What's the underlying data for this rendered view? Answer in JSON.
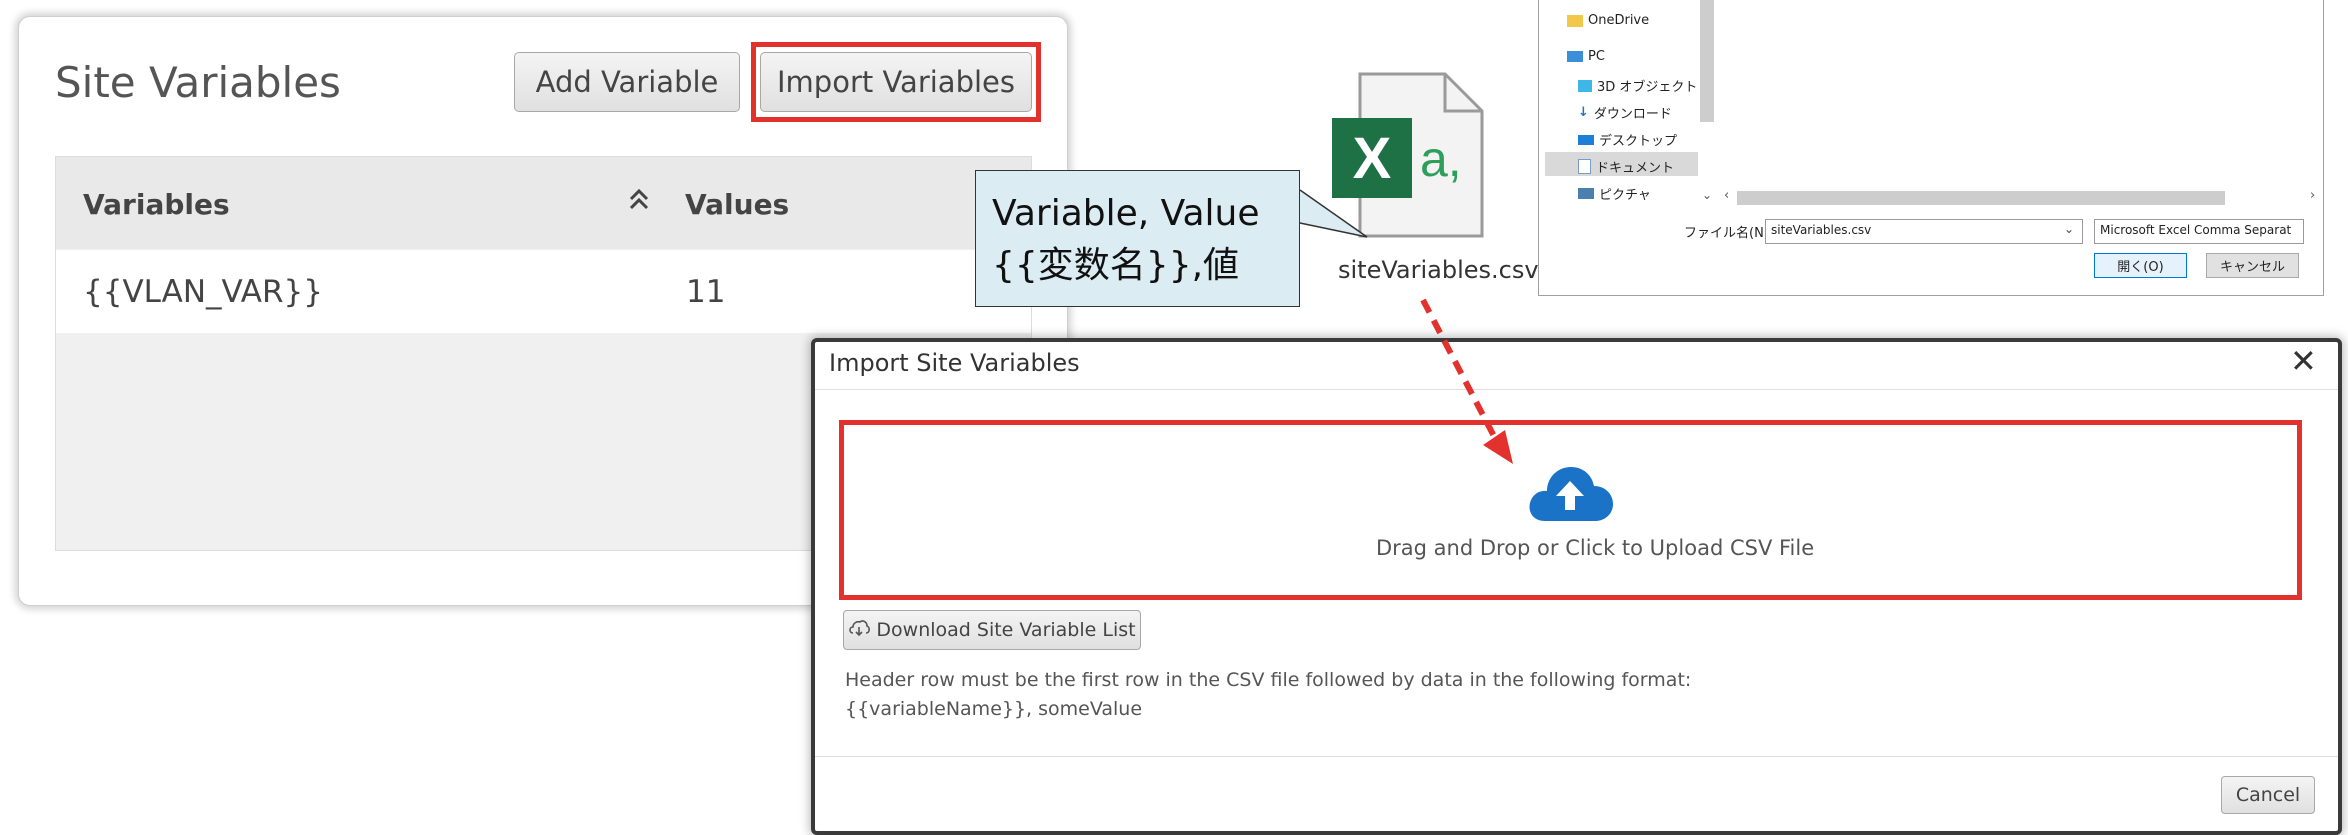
{
  "site_variables": {
    "title": "Site Variables",
    "add_label": "Add Variable",
    "import_label": "Import Variables",
    "columns": [
      "Variables",
      "Values"
    ],
    "rows": [
      {
        "variable": "{{VLAN_VAR}}",
        "value": "11"
      }
    ]
  },
  "callout": {
    "line1": "Variable, Value",
    "line2": "{{変数名}},値",
    "file_name": "siteVariables.csv",
    "file_icon_letter": "X",
    "file_icon_suffix": "a,"
  },
  "file_dialog": {
    "tree": [
      "OneDrive",
      "PC",
      "3D オブジェクト",
      "ダウンロード",
      "デスクトップ",
      "ドキュメント",
      "ピクチャ"
    ],
    "filename_label": "ファイル名(N):",
    "filename_value": "siteVariables.csv",
    "filter_value": "Microsoft Excel Comma Separat",
    "open_label": "開く(O)",
    "cancel_label": "キャンセル"
  },
  "import_modal": {
    "title": "Import Site Variables",
    "close_glyph": "✕",
    "drop_text": "Drag and Drop or Click to Upload CSV File",
    "download_label": "Download Site Variable List",
    "hint_line1": "Header row must be the first row in the CSV file followed by data in the following format:",
    "hint_line2": "{{variableName}}, someValue",
    "cancel_label": "Cancel"
  },
  "colors": {
    "highlight": "#e3322d",
    "upload_icon": "#1a73c6",
    "excel_green": "#1e7145",
    "callout_bg": "#dcecf3"
  }
}
